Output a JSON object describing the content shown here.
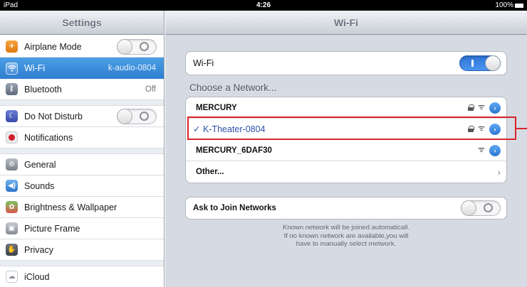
{
  "status_bar": {
    "device": "iPad",
    "time": "4:26",
    "battery": "100%"
  },
  "sidebar": {
    "title": "Settings",
    "items": [
      {
        "label": "Airplane Mode",
        "icon": "airplane-icon"
      },
      {
        "label": "Wi-Fi",
        "value": "k-audio-0804",
        "icon": "wifi-icon",
        "selected": true
      },
      {
        "label": "Bluetooth",
        "value": "Off",
        "icon": "bluetooth-icon"
      },
      {
        "label": "Do Not Disturb",
        "icon": "moon-icon"
      },
      {
        "label": "Notifications",
        "icon": "notifications-icon"
      },
      {
        "label": "General",
        "icon": "gear-icon"
      },
      {
        "label": "Sounds",
        "icon": "speaker-icon"
      },
      {
        "label": "Brightness & Wallpaper",
        "icon": "flower-icon"
      },
      {
        "label": "Picture Frame",
        "icon": "picture-frame-icon"
      },
      {
        "label": "Privacy",
        "icon": "hand-icon"
      },
      {
        "label": "iCloud",
        "icon": "cloud-icon"
      }
    ]
  },
  "detail": {
    "title": "Wi-Fi",
    "wifi_label": "Wi-Fi",
    "choose_network": "Choose a Network...",
    "networks": [
      {
        "name": "MERCURY",
        "locked": true
      },
      {
        "name": "K-Theater-0804",
        "locked": true,
        "connected": true,
        "check": "✓"
      },
      {
        "name": "MERCURY_6DAF30",
        "locked": false
      },
      {
        "name": "Other...",
        "other": true
      }
    ],
    "ask_to_join": "Ask to Join Networks",
    "note_lines": [
      "Known network will be joined automaticall.",
      "If no known network are available,you will",
      "have to manually select metwork."
    ]
  },
  "colors": {
    "accent": "#2f7ed0",
    "highlight_box": "#d9232b",
    "background": "#d6dbe3"
  }
}
